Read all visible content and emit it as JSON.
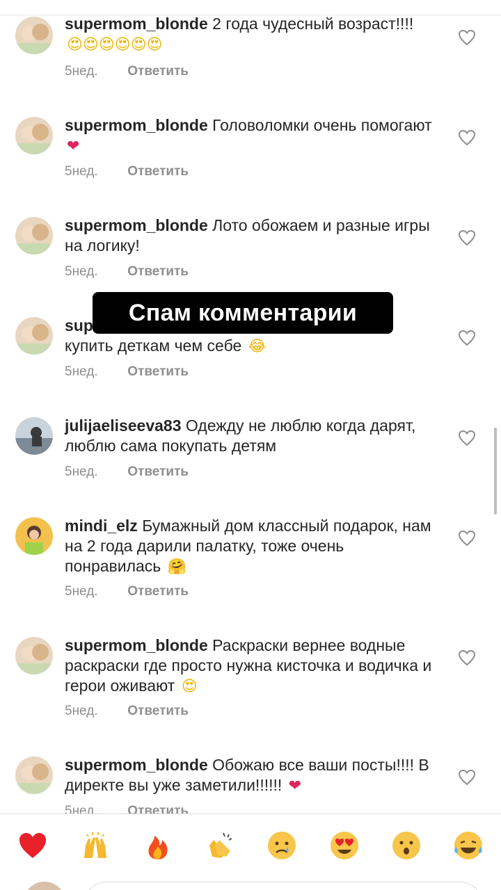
{
  "comments": [
    {
      "username": "supermom_blonde",
      "text": "2 года чудесный возраст!!!!",
      "emoji": "😍😍😍😍😍😍",
      "time": "5нед.",
      "reply": "Ответить"
    },
    {
      "username": "supermom_blonde",
      "text": "Головоломки очень помогают",
      "emoji": "❤",
      "time": "5нед.",
      "reply": "Ответить"
    },
    {
      "username": "supermom_blonde",
      "text": "Лото обожаем и разные игры на логику!",
      "emoji": "",
      "time": "5нед.",
      "reply": "Ответить"
    },
    {
      "username": "sup",
      "text": "купить деткам чем себе",
      "emoji": "😂",
      "time": "5нед.",
      "reply": "Ответить"
    },
    {
      "username": "julijaeliseeva83",
      "text": "Одежду не люблю когда дарят, люблю сама покупать детям",
      "emoji": "",
      "time": "5нед.",
      "reply": "Ответить"
    },
    {
      "username": "mindi_elz",
      "text": "Бумажный дом классный подарок, нам на 2 года дарили палатку, тоже очень понравилась",
      "emoji": "🤗",
      "time": "5нед.",
      "reply": "Ответить"
    },
    {
      "username": "supermom_blonde",
      "text": "Раскраски вернее водные раскраски где просто нужна кисточка и водичка и герои оживают",
      "emoji": "😍",
      "time": "5нед.",
      "reply": "Ответить"
    },
    {
      "username": "supermom_blonde",
      "text": "Обожаю все ваши посты!!!! В директе вы уже заметили!!!!!!",
      "emoji": "❤",
      "time": "5нед.",
      "reply": "Ответить"
    }
  ],
  "overlay_label": "Спам комментарии",
  "reactions": [
    "red-heart",
    "raising-hands",
    "fire",
    "clapping-hands",
    "crying-face",
    "heart-eyes",
    "surprised-face",
    "tears-of-joy"
  ],
  "colors": {
    "username": "#262626",
    "meta": "#8e8e8e",
    "heart": "#e0245e",
    "overlay_bg": "#000000"
  }
}
